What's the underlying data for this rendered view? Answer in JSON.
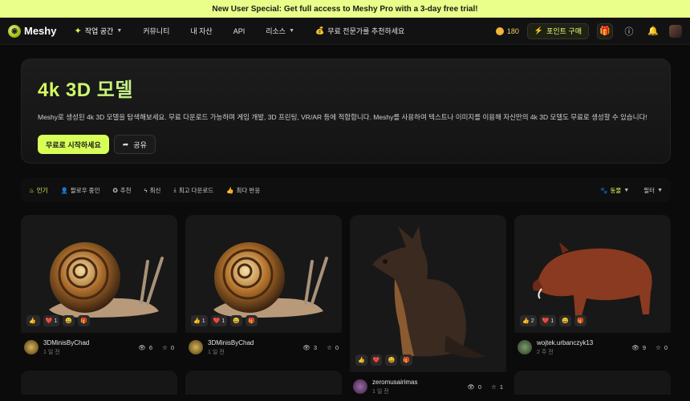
{
  "banner": {
    "text": "New User Special: Get full access to Meshy Pro with a 3-day free trial!"
  },
  "nav": {
    "logo": "Meshy",
    "items": [
      {
        "label": "작업 공간",
        "icon": "sparkle-icon",
        "caret": true
      },
      {
        "label": "커뮤니티"
      },
      {
        "label": "내 자산"
      },
      {
        "label": "API"
      },
      {
        "label": "리소스",
        "caret": true
      },
      {
        "label": "무료 전문가를 추천하세요",
        "icon": "money-bag-icon"
      }
    ],
    "credits": "180",
    "buy_label": "포인트 구매"
  },
  "hero": {
    "title": "4k 3D 모델",
    "description": "Meshy로 생성된 4k 3D 모델을 탐색해보세요. 무료 다운로드 가능하며 게임 개발, 3D 프린팅, VR/AR 등에 적합합니다. Meshy를 사용하여 텍스트나 이미지를 이용해 자신만의 4k 3D 모델도 무료로 생성할 수 있습니다!",
    "cta": "무료로 시작하세요",
    "share": "공유"
  },
  "filters": {
    "tabs": [
      {
        "label": "인기",
        "icon": "fire-icon",
        "active": true
      },
      {
        "label": "팔로우 중인",
        "icon": "user-icon"
      },
      {
        "label": "추천",
        "icon": "award-icon"
      },
      {
        "label": "최신",
        "icon": "bolt-icon"
      },
      {
        "label": "최고 다운로드",
        "icon": "download-icon"
      },
      {
        "label": "최다 반응",
        "icon": "thumb-up-icon"
      }
    ],
    "category": "동물",
    "filter_label": "필터"
  },
  "cards": [
    {
      "author": "3DMinisByChad",
      "ago": "1 일 전",
      "views": "6",
      "stars": "0",
      "reactions": [
        {
          "e": "👍",
          "n": ""
        },
        {
          "e": "❤️",
          "n": "1"
        },
        {
          "e": "😄",
          "n": ""
        },
        {
          "e": "🎁",
          "n": ""
        }
      ]
    },
    {
      "author": "3DMinisByChad",
      "ago": "1 일 전",
      "views": "3",
      "stars": "0",
      "reactions": [
        {
          "e": "👍",
          "n": "1"
        },
        {
          "e": "❤️",
          "n": "1"
        },
        {
          "e": "😄",
          "n": ""
        },
        {
          "e": "🎁",
          "n": ""
        }
      ]
    },
    {
      "author": "zeromusairimas",
      "ago": "1 일 전",
      "views": "0",
      "stars": "1",
      "reactions": [
        {
          "e": "👍",
          "n": ""
        },
        {
          "e": "❤️",
          "n": ""
        },
        {
          "e": "😄",
          "n": ""
        },
        {
          "e": "🎁",
          "n": ""
        }
      ]
    },
    {
      "author": "wojtek.urbanczyk13",
      "ago": "2 주 전",
      "views": "9",
      "stars": "0",
      "reactions": [
        {
          "e": "👍",
          "n": "2"
        },
        {
          "e": "❤️",
          "n": "1"
        },
        {
          "e": "😄",
          "n": ""
        },
        {
          "e": "🎁",
          "n": ""
        }
      ]
    }
  ]
}
